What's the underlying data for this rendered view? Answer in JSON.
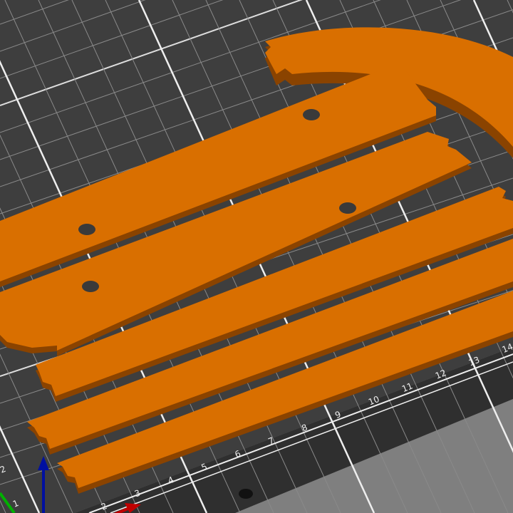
{
  "viewport": {
    "name": "3D plater view"
  },
  "ruler": {
    "front_labels": [
      "2",
      "3",
      "4",
      "5",
      "6",
      "7",
      "8",
      "9",
      "10",
      "11",
      "12",
      "13",
      "14"
    ],
    "left_labels": [
      "1",
      "2"
    ]
  },
  "colors": {
    "part": "#d96f00",
    "part_side": "#8a4300",
    "bed": "#3e3e3e",
    "grid": "#8a8a8a",
    "axis_x": "#c00000",
    "axis_y": "#00b000",
    "axis_z": "#0010a0"
  }
}
